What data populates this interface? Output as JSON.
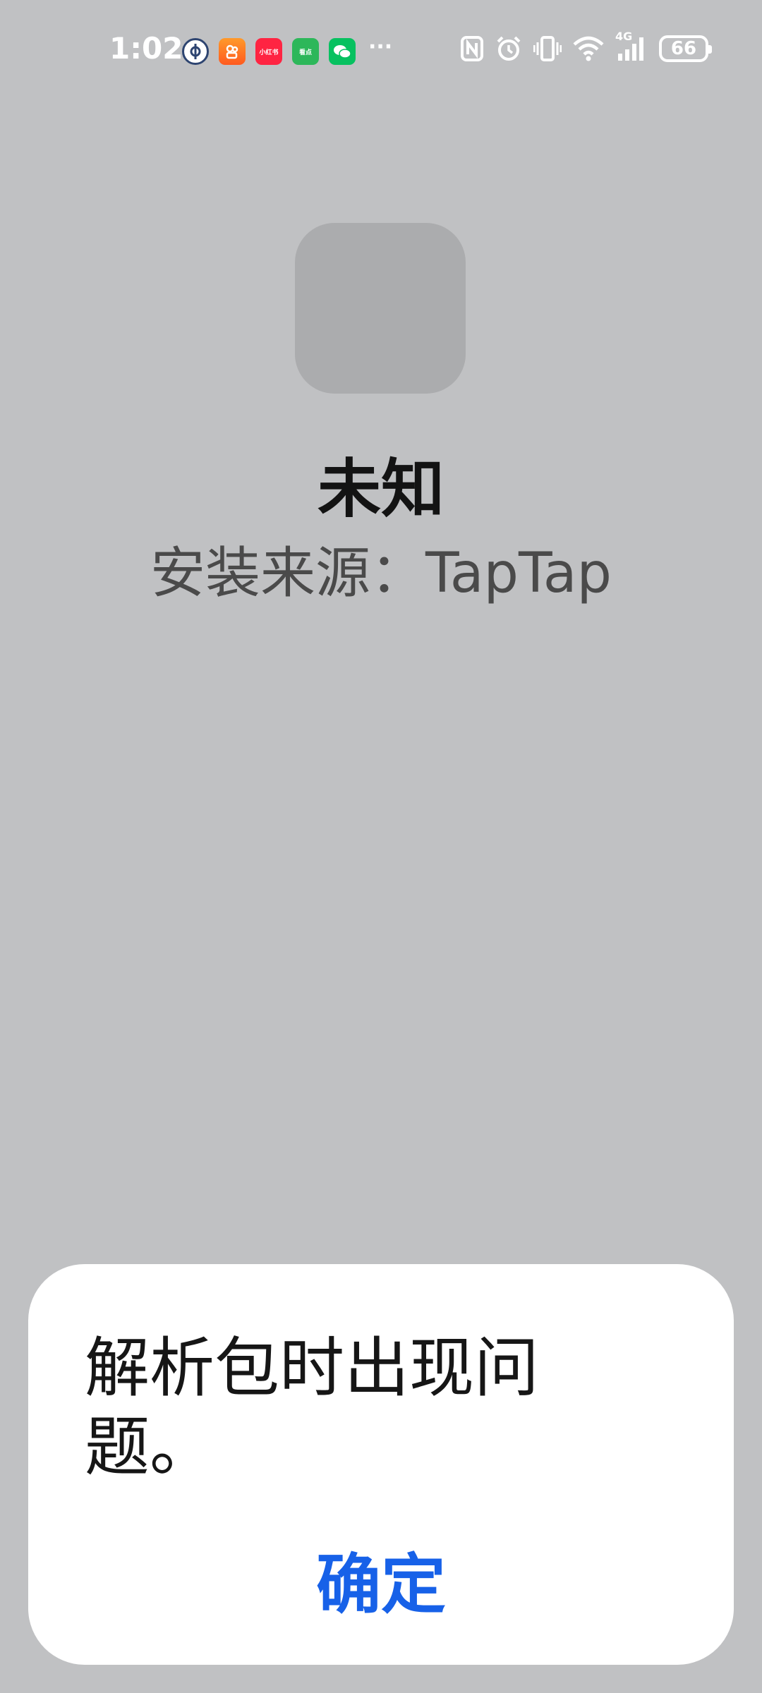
{
  "status_bar": {
    "time": "1:02",
    "notification_icons": [
      "railway-12306-icon",
      "kuaishou-icon",
      "xiaohongshu-icon",
      "kandian-icon",
      "wechat-icon"
    ],
    "notification_labels": {
      "xiaohongshu": "小红书",
      "kandian": "看点"
    },
    "more": "···",
    "system_icons": [
      "nfc-icon",
      "alarm-icon",
      "vibrate-icon",
      "wifi-icon",
      "signal-4g-icon"
    ],
    "network_label": "4G",
    "battery": "66"
  },
  "app_info": {
    "name": "未知",
    "source": "安装来源：TapTap"
  },
  "dialog": {
    "message": "解析包时出现问题。",
    "confirm_label": "确定"
  },
  "colors": {
    "background": "#c0c1c3",
    "accent": "#1761e8"
  }
}
